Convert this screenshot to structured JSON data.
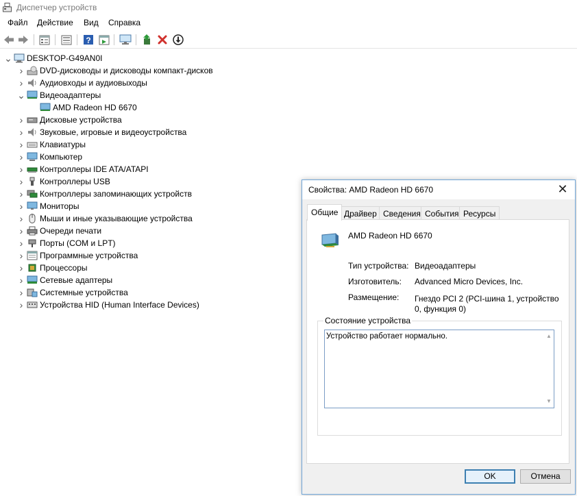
{
  "window": {
    "title": "Диспетчер устройств"
  },
  "menu": [
    "Файл",
    "Действие",
    "Вид",
    "Справка"
  ],
  "toolbar": {
    "icons": [
      "back-arrow-icon",
      "forward-arrow-icon",
      "properties-icon",
      "view-icon",
      "help-icon",
      "show-hidden-icon",
      "scan-hardware-icon",
      "update-driver-icon",
      "uninstall-icon",
      "disable-device-icon"
    ]
  },
  "tree": {
    "root": "DESKTOP-G49AN0I",
    "categories": [
      {
        "label": "DVD-дисководы и дисководы компакт-дисков",
        "icon": "dvd-drive-icon",
        "expanded": false
      },
      {
        "label": "Аудиовходы и аудиовыходы",
        "icon": "speaker-icon",
        "expanded": false
      },
      {
        "label": "Видеоадаптеры",
        "icon": "display-adapter-icon",
        "expanded": true,
        "children": [
          "AMD Radeon HD 6670"
        ]
      },
      {
        "label": "Дисковые устройства",
        "icon": "disk-drive-icon",
        "expanded": false
      },
      {
        "label": "Звуковые, игровые и видеоустройства",
        "icon": "speaker-icon",
        "expanded": false
      },
      {
        "label": "Клавиатуры",
        "icon": "keyboard-icon",
        "expanded": false
      },
      {
        "label": "Компьютер",
        "icon": "computer-icon",
        "expanded": false
      },
      {
        "label": "Контроллеры IDE ATA/ATAPI",
        "icon": "ide-controller-icon",
        "expanded": false
      },
      {
        "label": "Контроллеры USB",
        "icon": "usb-icon",
        "expanded": false
      },
      {
        "label": "Контроллеры запоминающих устройств",
        "icon": "storage-controller-icon",
        "expanded": false
      },
      {
        "label": "Мониторы",
        "icon": "monitor-icon",
        "expanded": false
      },
      {
        "label": "Мыши и иные указывающие устройства",
        "icon": "mouse-icon",
        "expanded": false
      },
      {
        "label": "Очереди печати",
        "icon": "printer-icon",
        "expanded": false
      },
      {
        "label": "Порты (COM и LPT)",
        "icon": "port-icon",
        "expanded": false
      },
      {
        "label": "Программные устройства",
        "icon": "software-device-icon",
        "expanded": false
      },
      {
        "label": "Процессоры",
        "icon": "processor-icon",
        "expanded": false
      },
      {
        "label": "Сетевые адаптеры",
        "icon": "network-adapter-icon",
        "expanded": false
      },
      {
        "label": "Системные устройства",
        "icon": "system-device-icon",
        "expanded": false
      },
      {
        "label": "Устройства HID (Human Interface Devices)",
        "icon": "hid-icon",
        "expanded": false
      }
    ]
  },
  "dialog": {
    "title": "Свойства: AMD Radeon HD 6670",
    "tabs": [
      "Общие",
      "Драйвер",
      "Сведения",
      "События",
      "Ресурсы"
    ],
    "active_tab": "Общие",
    "device_name": "AMD Radeon HD 6670",
    "properties": [
      {
        "label": "Тип устройства:",
        "value": "Видеоадаптеры"
      },
      {
        "label": "Изготовитель:",
        "value": "Advanced Micro Devices, Inc."
      },
      {
        "label": "Размещение:",
        "value": "Гнездо PCI 2 (PCI-шина 1, устройство 0, функция 0)"
      }
    ],
    "status_group_label": "Состояние устройства",
    "status_text": "Устройство работает нормально.",
    "ok_label": "OK",
    "cancel_label": "Отмена"
  },
  "colors": {
    "dialog_border": "#6fa4d6",
    "default_button_border": "#3c7fb1",
    "delete_icon": "#d0312d",
    "go_icon": "#2e9a3a"
  }
}
